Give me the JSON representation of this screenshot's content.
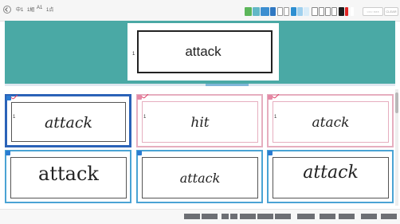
{
  "header": {
    "crumbs": [
      "中1",
      "1組",
      "A1",
      "1点"
    ],
    "search_placeholder": "○○○ ×××",
    "clear_label": "CLEAR"
  },
  "question": {
    "number": "1",
    "text": "attack"
  },
  "answers": [
    {
      "number": "1",
      "text": "attack",
      "state": "selected"
    },
    {
      "number": "1",
      "text": "hit",
      "state": "wrong"
    },
    {
      "number": "1",
      "text": "atack",
      "state": "wrong"
    },
    {
      "number": "",
      "text": "attack",
      "state": "default"
    },
    {
      "number": "",
      "text": "attack",
      "state": "default"
    },
    {
      "number": "",
      "text": "attack",
      "state": "default"
    }
  ],
  "colors": {
    "teal": "#4aa9a5",
    "selected_border": "#2b63b8",
    "wrong_border": "#e6aebf",
    "default_border": "#4aa3d4",
    "check_mark": "#e0466a",
    "tag_blue": "#2a7bd1",
    "tag_pink": "#e48aa6"
  },
  "icons": [
    "back-icon",
    "zoom-in-icon",
    "zoom-out-icon",
    "pen-icon",
    "undo-icon",
    "redo-icon",
    "eraser-icon",
    "color-red-icon"
  ]
}
